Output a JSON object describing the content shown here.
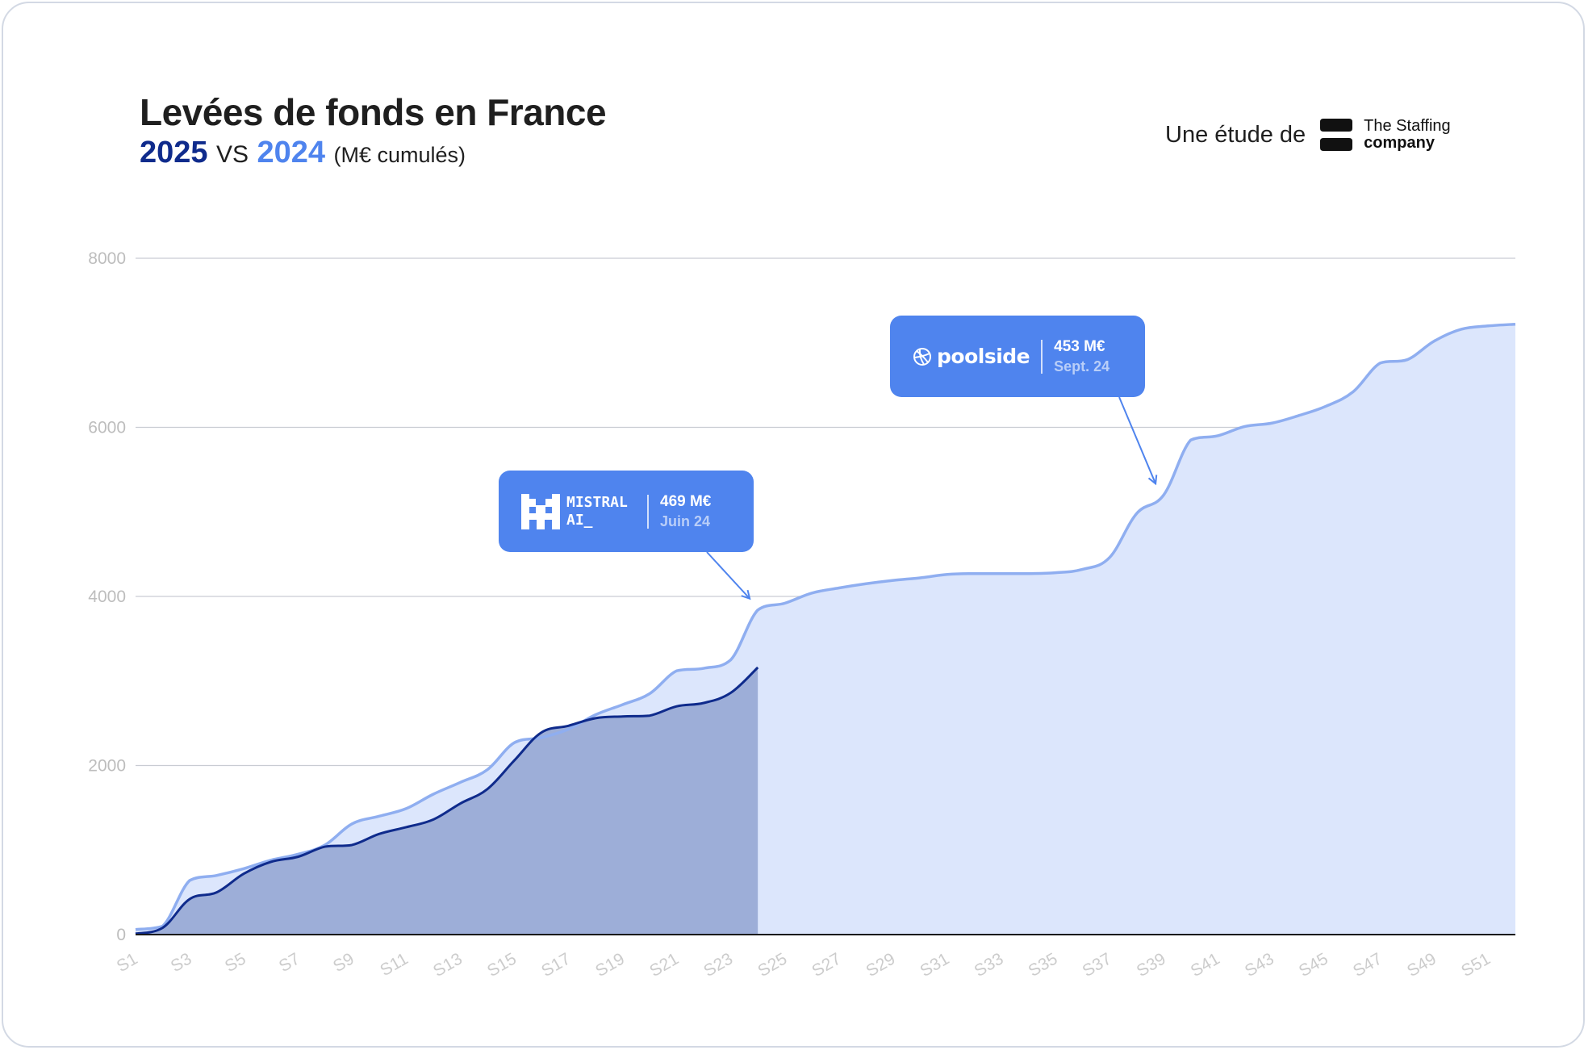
{
  "header": {
    "title": "Levées de fonds en France",
    "subtitle_year_a": "2025",
    "subtitle_vs": "VS",
    "subtitle_year_b": "2024",
    "subtitle_unit": "(M€ cumulés)"
  },
  "credit": {
    "label": "Une étude de",
    "brand_line1": "The Staffing",
    "brand_line2": "company",
    "logo_icon": "staffing-s-logo-icon"
  },
  "callouts": {
    "mistral": {
      "logo_icon": "mistral-m-logo-icon",
      "name_line1": "MISTRAL",
      "name_line2": "AI_",
      "amount": "469 M€",
      "date": "Juin 24",
      "points_to_week": "S24"
    },
    "poolside": {
      "logo_icon": "poolside-ball-logo-icon",
      "name": "poolside",
      "amount": "453 M€",
      "date": "Sept. 24",
      "points_to_week": "S39"
    }
  },
  "colors": {
    "series_2025": "#0f2b8c",
    "series_2025_fill": "#9daed8",
    "series_2024": "#8faef0",
    "series_2024_fill": "#dce6fc",
    "callout_bg": "#4f84ee"
  },
  "chart_data": {
    "type": "area",
    "x": [
      "S1",
      "S2",
      "S3",
      "S4",
      "S5",
      "S6",
      "S7",
      "S8",
      "S9",
      "S10",
      "S11",
      "S12",
      "S13",
      "S14",
      "S15",
      "S16",
      "S17",
      "S18",
      "S19",
      "S20",
      "S21",
      "S22",
      "S23",
      "S24",
      "S25",
      "S26",
      "S27",
      "S28",
      "S29",
      "S30",
      "S31",
      "S32",
      "S33",
      "S34",
      "S35",
      "S36",
      "S37",
      "S38",
      "S39",
      "S40",
      "S41",
      "S42",
      "S43",
      "S44",
      "S45",
      "S46",
      "S47",
      "S48",
      "S49",
      "S50",
      "S51",
      "S52"
    ],
    "x_tick_labels": [
      "S1",
      "S3",
      "S5",
      "S7",
      "S9",
      "S11",
      "S13",
      "S15",
      "S17",
      "S19",
      "S21",
      "S23",
      "S25",
      "S27",
      "S29",
      "S31",
      "S33",
      "S35",
      "S37",
      "S39",
      "S41",
      "S43",
      "S45",
      "S47",
      "S49",
      "S51"
    ],
    "series": [
      {
        "name": "2024",
        "values": [
          60,
          100,
          640,
          700,
          780,
          880,
          950,
          1060,
          1310,
          1400,
          1490,
          1660,
          1800,
          1950,
          2270,
          2330,
          2430,
          2600,
          2720,
          2850,
          3120,
          3150,
          3250,
          3840,
          3920,
          4040,
          4100,
          4150,
          4190,
          4220,
          4260,
          4270,
          4270,
          4270,
          4280,
          4320,
          4460,
          4980,
          5200,
          5850,
          5900,
          6010,
          6050,
          6140,
          6250,
          6420,
          6760,
          6800,
          7020,
          7160,
          7200,
          7220
        ]
      },
      {
        "name": "2025",
        "values": [
          10,
          80,
          420,
          500,
          720,
          860,
          920,
          1040,
          1060,
          1190,
          1270,
          1360,
          1550,
          1720,
          2060,
          2390,
          2470,
          2560,
          2580,
          2590,
          2700,
          2740,
          2860,
          3160
        ]
      }
    ],
    "ylim": [
      0,
      8000
    ],
    "yticks": [
      0,
      2000,
      4000,
      6000,
      8000
    ],
    "grid": true,
    "legend": "in subtitle"
  }
}
